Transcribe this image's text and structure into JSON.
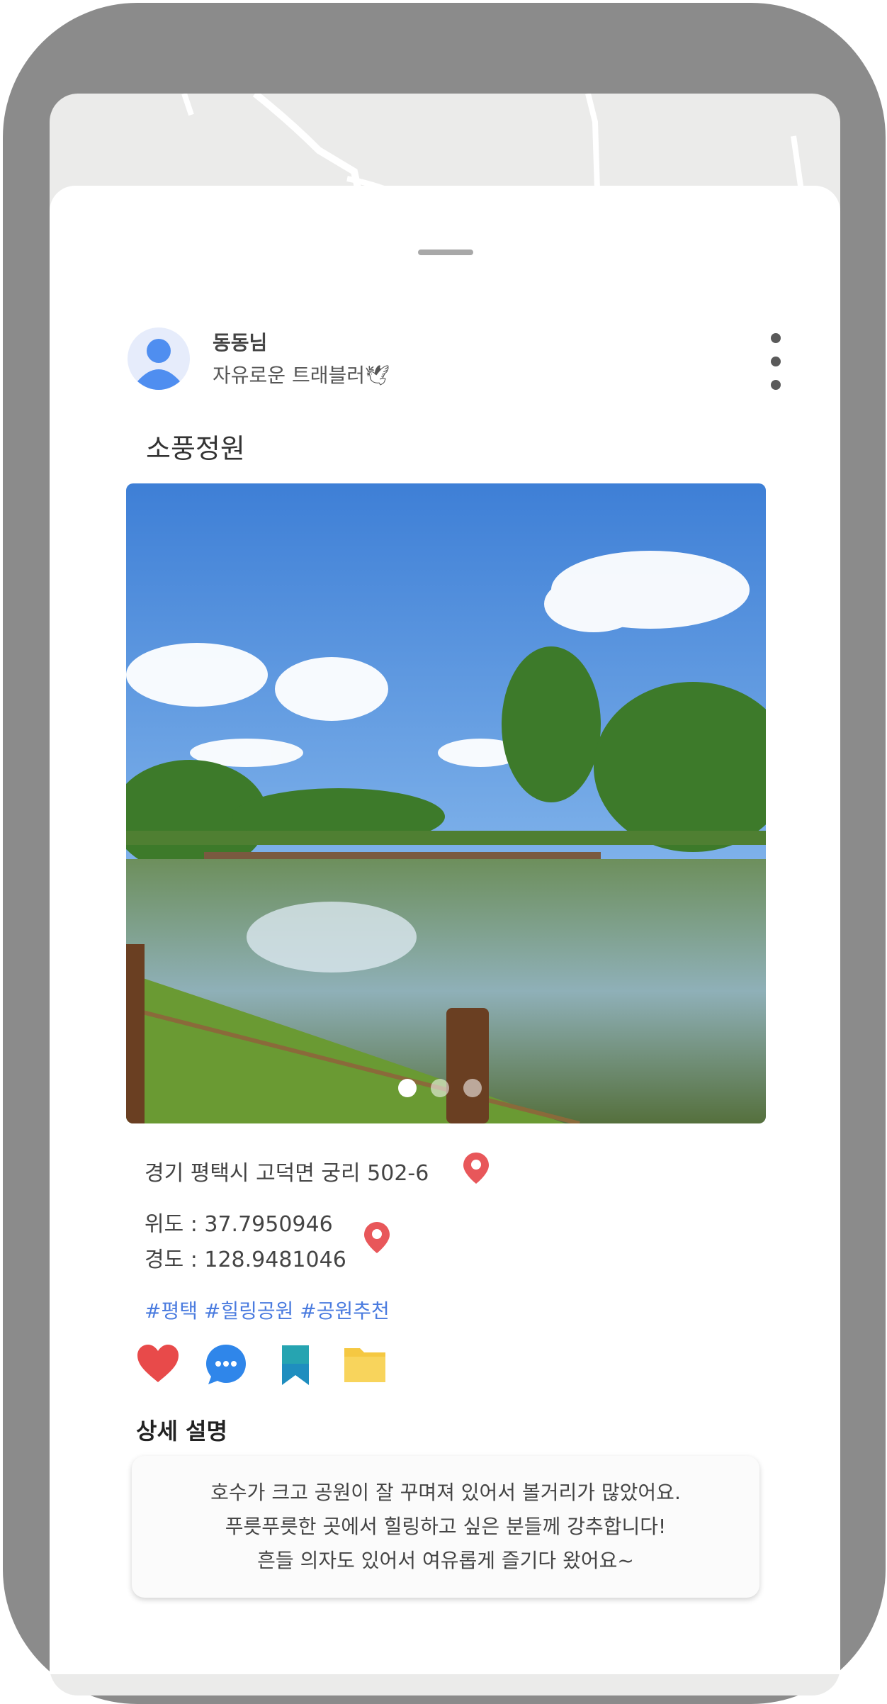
{
  "user": {
    "name": "동동님",
    "bio": "자유로운 트래블러🕊"
  },
  "post": {
    "title": "소풍정원",
    "photo_count": 3,
    "active_photo_index": 0,
    "address": "경기 평택시 고덕면 궁리 502-6",
    "latitude": "위도 : 37.7950946",
    "longitude": "경도 : 128.9481046",
    "tags": "#평택 #힐링공원 #공원추천"
  },
  "actions": {
    "icons": [
      "heart-icon",
      "chat-icon",
      "bookmark-icon",
      "folder-icon"
    ]
  },
  "detail": {
    "heading": "상세 설명",
    "lines": [
      "호수가 크고 공원이 잘 꾸며져 있어서 볼거리가 많았어요.",
      "푸릇푸릇한 곳에서 힐링하고 싶은 분들께 강추합니다!",
      "흔들 의자도 있어서 여유롭게 즐기다 왔어요~"
    ]
  },
  "colors": {
    "frame": "#8b8b8b",
    "accent": "#4a7bdf",
    "pin": "#e8575a",
    "heart": "#e84a4a",
    "chat": "#2f86ea",
    "bookmark": "#1f8ebf",
    "folder": "#f5c842"
  }
}
